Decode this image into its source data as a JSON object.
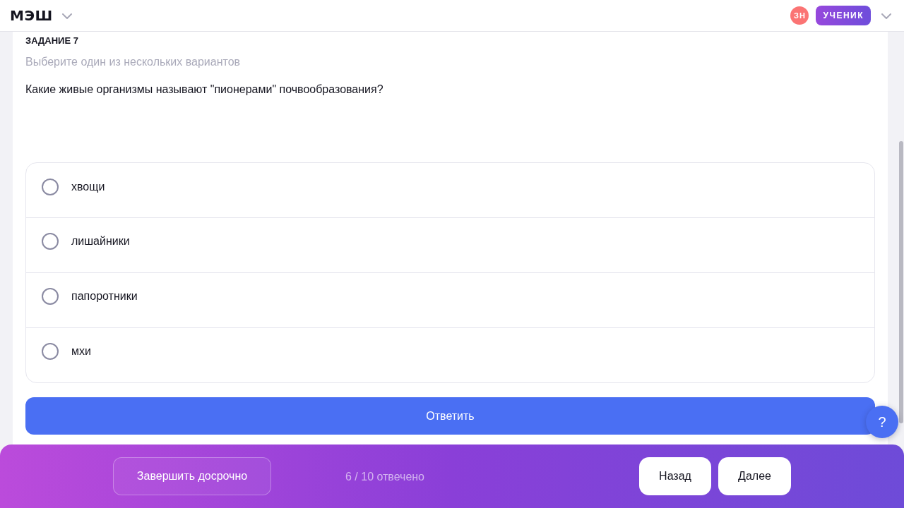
{
  "header": {
    "logo": "МЭШ",
    "avatar_initials": "ЗН",
    "role_badge": "УЧЕНИК"
  },
  "task": {
    "label": "ЗАДАНИЕ 7",
    "instruction": "Выберите один из нескольких вариантов",
    "question": "Какие живые организмы называют \"пионерами\" почвообразования?"
  },
  "options": [
    {
      "label": "хвощи",
      "selected": false
    },
    {
      "label": "лишайники",
      "selected": false
    },
    {
      "label": "папоротники",
      "selected": false
    },
    {
      "label": "мхи",
      "selected": false
    }
  ],
  "answer_button": "Ответить",
  "help_button": "?",
  "footer": {
    "finish_button": "Завершить досрочно",
    "progress": "6 / 10 отвечено",
    "back_button": "Назад",
    "next_button": "Далее"
  }
}
